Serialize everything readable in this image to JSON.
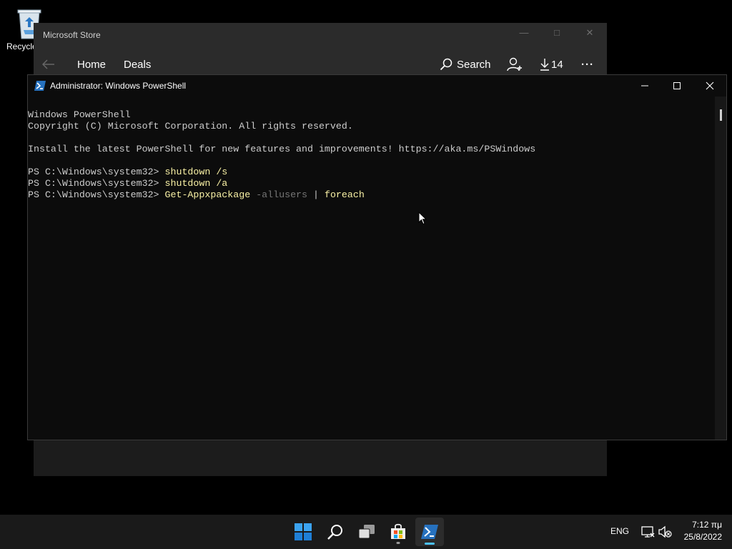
{
  "desktop": {
    "recycle_bin_label": "Recycle"
  },
  "store": {
    "title": "Microsoft Store",
    "nav_home": "Home",
    "nav_deals": "Deals",
    "search_label": "Search",
    "downloads_count": "14",
    "more_label": "···"
  },
  "powershell": {
    "title": "Administrator: Windows PowerShell",
    "lines": {
      "l1": "Windows PowerShell",
      "l2": "Copyright (C) Microsoft Corporation. All rights reserved.",
      "l3": "Install the latest PowerShell for new features and improvements! https://aka.ms/PSWindows",
      "prompt": "PS C:\\Windows\\system32> ",
      "cmd1": "shutdown /s",
      "cmd2": "shutdown /a",
      "cmd3_name": "Get-Appxpackage",
      "cmd3_param": " -allusers",
      "cmd3_pipe": " | ",
      "cmd3_tail": "foreach"
    }
  },
  "taskbar": {
    "lang": "ENG",
    "time": "7:12 πμ",
    "date": "25/8/2022"
  },
  "colors": {
    "accent": "#4cc2ff",
    "console_bg": "#0c0c0c",
    "console_text": "#cccccc",
    "command_yellow": "#f9f1a5",
    "param_gray": "#767676"
  }
}
